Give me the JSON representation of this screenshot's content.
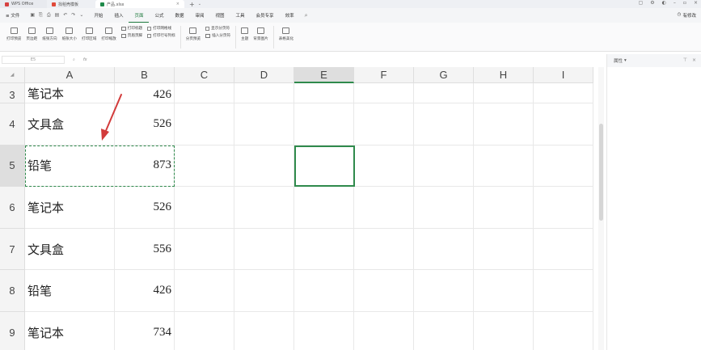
{
  "titlebar": {
    "tabs": [
      "WPS Office",
      "找稻壳模板",
      "产品.xlsx"
    ],
    "add_tab": "+"
  },
  "menubar": {
    "file": "≡ 文件",
    "items": [
      "开始",
      "插入",
      "页面",
      "公式",
      "数据",
      "审阅",
      "视图",
      "工具",
      "会员专享",
      "效率"
    ],
    "active_index": 2,
    "right": "有修改"
  },
  "ribbon": {
    "buttons": [
      "打印预览",
      "页边距",
      "纸张方向",
      "纸张大小",
      "打印区域",
      "打印缩放"
    ],
    "checks_a": [
      "打印标题",
      "页眉页脚"
    ],
    "checks_b": [
      "打印网格线",
      "打印行号列标"
    ],
    "break_preview": "分页预览",
    "checks_c": [
      "显示分页符",
      "插入分页符"
    ],
    "theme": "主题",
    "background": "背景图片",
    "beautify": "表格美化"
  },
  "formula_bar": {
    "name_box": "E5",
    "fx": "fx"
  },
  "properties_panel": {
    "title": "属性"
  },
  "colors": {
    "accent": "#2f8a4c",
    "arrow": "#d23b3b"
  },
  "sheet": {
    "columns": [
      "A",
      "B",
      "C",
      "D",
      "E",
      "F",
      "G",
      "H",
      "I"
    ],
    "selected_column": "E",
    "rows": [
      {
        "num": "3",
        "a": "笔记本",
        "b": "426"
      },
      {
        "num": "4",
        "a": "文具盒",
        "b": "526"
      },
      {
        "num": "5",
        "a": "铅笔",
        "b": "873"
      },
      {
        "num": "6",
        "a": "笔记本",
        "b": "526"
      },
      {
        "num": "7",
        "a": "文具盒",
        "b": "556"
      },
      {
        "num": "8",
        "a": "铅笔",
        "b": "426"
      },
      {
        "num": "9",
        "a": "笔记本",
        "b": "734"
      }
    ],
    "selected_row": "5"
  }
}
